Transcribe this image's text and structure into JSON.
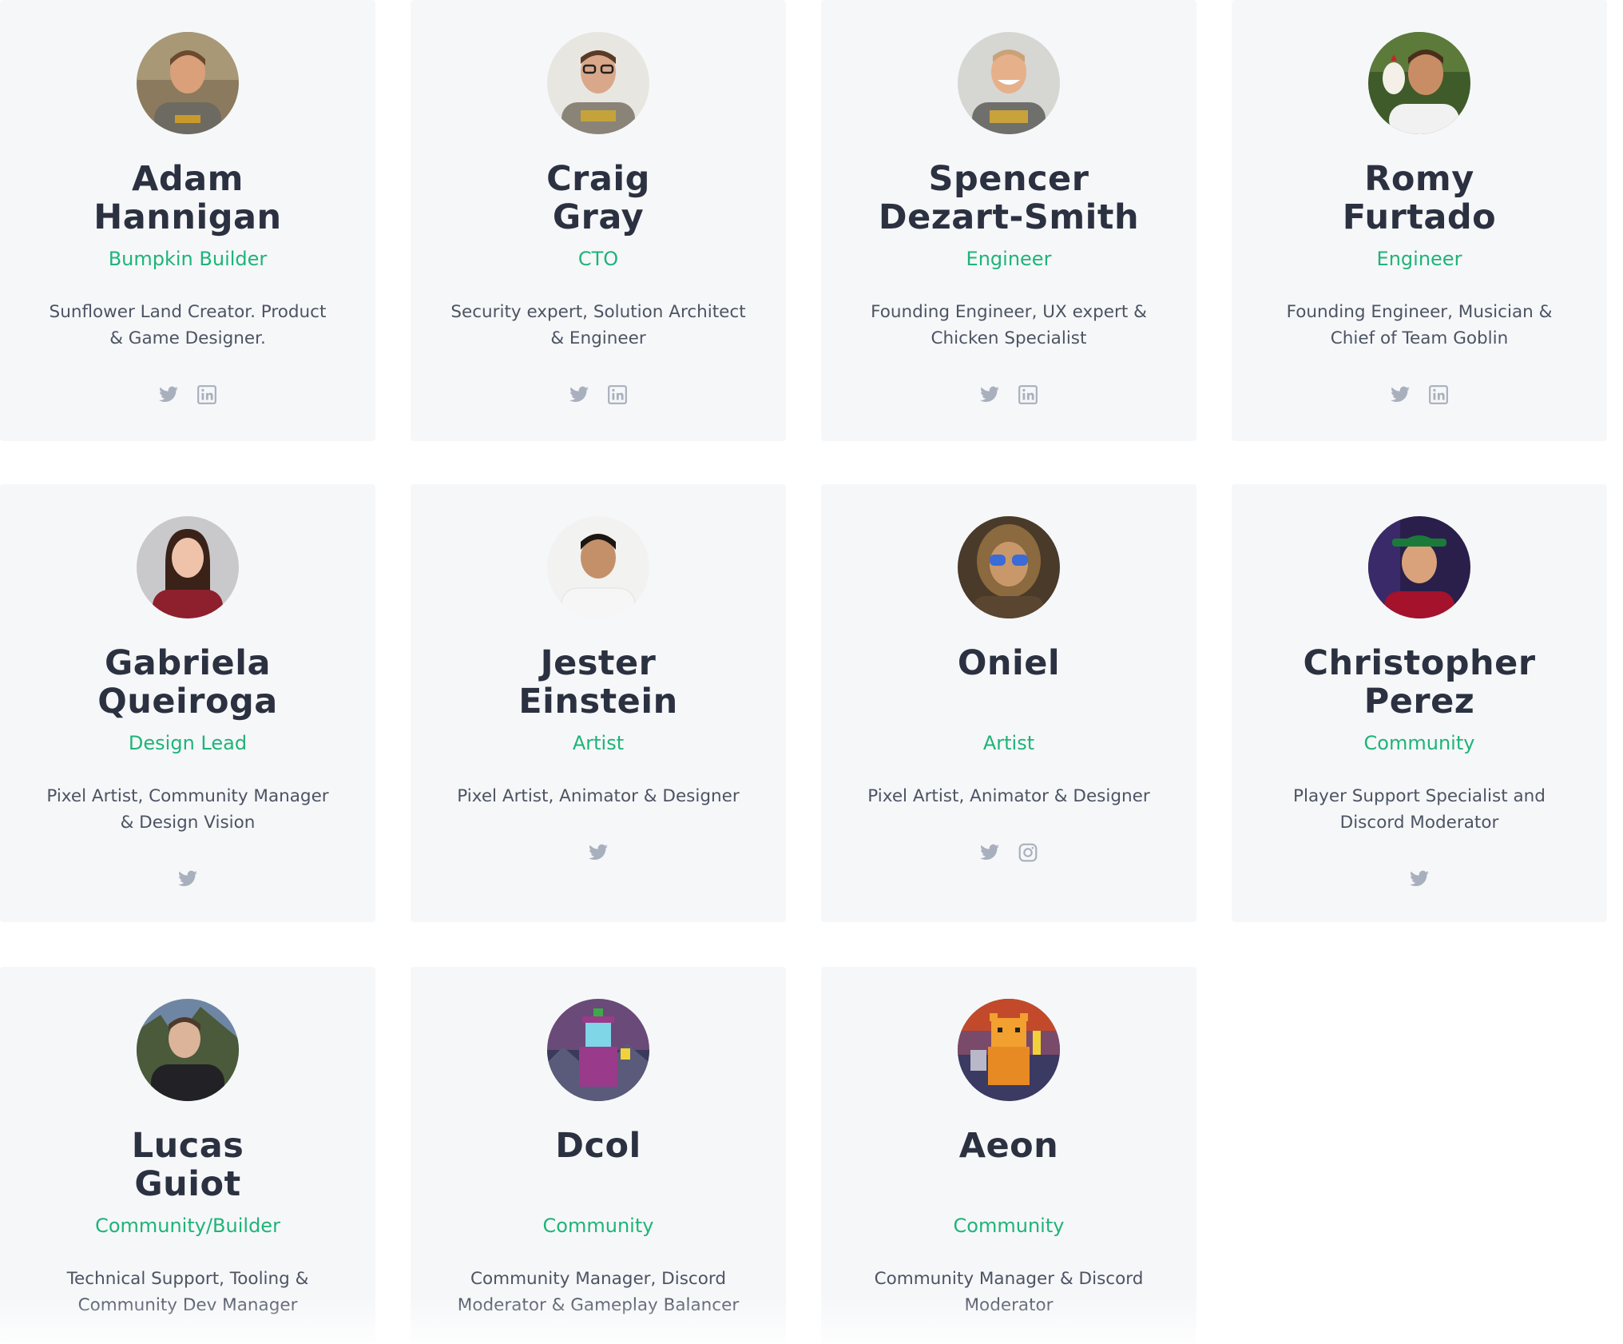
{
  "team": [
    {
      "first": "Adam",
      "last": "Hannigan",
      "role": "Bumpkin Builder",
      "bio1": "Sunflower Land Creator. Product",
      "bio2": "& Game Designer.",
      "avatar_colors": {
        "bg": "#8b7a5e",
        "skin": "#d9a07a",
        "shirt": "#6d6a62",
        "hair": "#6b4a2e"
      }
    },
    {
      "first": "Craig",
      "last": "Gray",
      "role": "CTO",
      "bio1": "Security expert, Solution Architect",
      "bio2": "& Engineer",
      "avatar_colors": {
        "bg": "#e8e6e1",
        "skin": "#d9a88a",
        "shirt": "#8a8478",
        "hair": "#5a3a26"
      }
    },
    {
      "first": "Spencer",
      "last": "Dezart-Smith",
      "role": "Engineer",
      "bio1": "Founding Engineer, UX expert &",
      "bio2": "Chicken Specialist",
      "avatar_colors": {
        "bg": "#d6d6d3",
        "skin": "#e6b08a",
        "shirt": "#6f6f6c",
        "hair": "#c9a277"
      }
    },
    {
      "first": "Romy",
      "last": "Furtado",
      "role": "Engineer",
      "bio1": "Founding Engineer, Musician &",
      "bio2": "Chief of Team Goblin",
      "avatar_colors": {
        "bg": "#3f5b2a",
        "skin": "#c98d66",
        "shirt": "#f1f1f1",
        "hair": "#4a2e1c"
      }
    },
    {
      "first": "Gabriela",
      "last": "Queiroga",
      "role": "Design Lead",
      "bio1": "Pixel Artist, Community Manager",
      "bio2": "& Design Vision",
      "avatar_colors": {
        "bg": "#c9c9cc",
        "skin": "#eec3aa",
        "shirt": "#8e1f2c",
        "hair": "#3a2219"
      }
    },
    {
      "first": "Jester",
      "last": "Einstein",
      "role": "Artist",
      "bio1": "Pixel Artist, Animator & Designer",
      "bio2": "",
      "avatar_colors": {
        "bg": "#f2f2f0",
        "skin": "#c4906a",
        "shirt": "#f6f6f6",
        "hair": "#1c1612"
      }
    },
    {
      "first": "Oniel",
      "last": "",
      "role": "Artist",
      "bio1": "Pixel Artist, Animator & Designer",
      "bio2": "",
      "avatar_colors": {
        "bg": "#4a3a2a",
        "skin": "#c9986a",
        "shirt": "#5a4530",
        "hair": "#8a6a3e"
      }
    },
    {
      "first": "Christopher",
      "last": "Perez",
      "role": "Community",
      "bio1": "Player Support Specialist and",
      "bio2": "Discord Moderator",
      "avatar_colors": {
        "bg": "#2a1f4a",
        "skin": "#d9a27a",
        "shirt": "#a4122c",
        "hair": "#1b7a3a"
      }
    },
    {
      "first": "Lucas",
      "last": "Guiot",
      "role": "Community/Builder",
      "bio1": "Technical Support, Tooling &",
      "bio2": "Community Dev Manager",
      "avatar_colors": {
        "bg": "#6e86a4",
        "skin": "#dcb49a",
        "shirt": "#222226",
        "hair": "#4e3a2a"
      }
    },
    {
      "first": "Dcol",
      "last": "",
      "role": "Community",
      "bio1": "Community Manager, Discord",
      "bio2": "Moderator & Gameplay Balancer",
      "avatar_colors": {
        "bg": "#6a4a78",
        "skin": "#7fd6e6",
        "shirt": "#9a3a8a",
        "hair": "#3fa84a"
      }
    },
    {
      "first": "Aeon",
      "last": "",
      "role": "Community",
      "bio1": "Community Manager & Discord",
      "bio2": "Moderator",
      "avatar_colors": {
        "bg": "#3a3a62",
        "skin": "#f2a030",
        "shirt": "#e88a24",
        "hair": "#c24a2a"
      }
    }
  ],
  "social_icons": {
    "twitter": "twitter-icon",
    "linkedin": "linkedin-icon",
    "instagram": "instagram-icon"
  },
  "colors": {
    "card_bg": "#f6f7f9",
    "name": "#2b3140",
    "role": "#1eb478",
    "bio": "#4c5463",
    "icon": "#a9b0bd"
  }
}
